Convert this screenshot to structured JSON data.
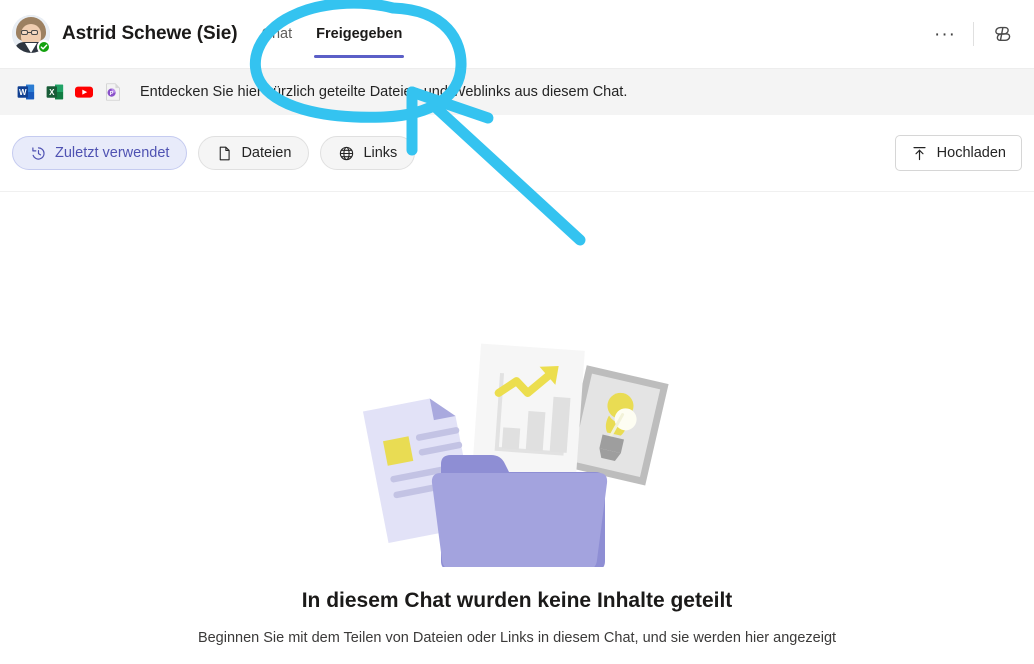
{
  "window": {
    "app": "Microsoft Teams",
    "background_color": "#ffffff"
  },
  "header": {
    "chat_title": "Astrid Schewe (Sie)",
    "avatar": {
      "name": "avatar",
      "presence_status": "available",
      "presence_color": "#13a10e"
    },
    "tabs": [
      {
        "label": "Chat",
        "active": false
      },
      {
        "label": "Freigegeben",
        "active": true
      }
    ],
    "active_tab_indicator_color": "#5b5fc7",
    "actions": [
      {
        "name": "more-options-button",
        "glyph": "···"
      },
      {
        "name": "copilot-button",
        "glyph": "copilot-icon"
      }
    ]
  },
  "banner": {
    "text": "Entdecken Sie hier kürzlich geteilte Dateien und Weblinks aus diesem Chat.",
    "background_color": "#f4f4f4",
    "app_icons": [
      {
        "name": "word-icon",
        "label": "W",
        "color": "#2b579a"
      },
      {
        "name": "excel-icon",
        "label": "X",
        "color": "#217346"
      },
      {
        "name": "youtube-icon",
        "label": "▶",
        "color": "#ff0000"
      },
      {
        "name": "powerpoint-icon",
        "label": "P",
        "color": "#b7472a"
      }
    ]
  },
  "filterbar": {
    "filters": [
      {
        "name": "filter-recent",
        "label": "Zuletzt verwendet",
        "icon": "history-icon",
        "selected": true
      },
      {
        "name": "filter-files",
        "label": "Dateien",
        "icon": "document-icon",
        "selected": false
      },
      {
        "name": "filter-links",
        "label": "Links",
        "icon": "globe-icon",
        "selected": false
      }
    ],
    "selected_pill_bg": "#e8ebfa",
    "selected_pill_fg": "#4f52b2",
    "upload": {
      "label": "Hochladen",
      "icon": "upload-arrow-icon"
    }
  },
  "empty_state": {
    "illustration": "folder-with-documents-illustration",
    "title": "In diesem Chat wurden keine Inhalte geteilt",
    "subtitle": "Beginnen Sie mit dem Teilen von Dateien oder Links in diesem Chat, und sie werden hier angezeigt"
  },
  "annotation": {
    "color": "#34c3f0",
    "shapes": [
      "ellipse-around-tabs",
      "arrow-pointing-to-tabs"
    ]
  }
}
